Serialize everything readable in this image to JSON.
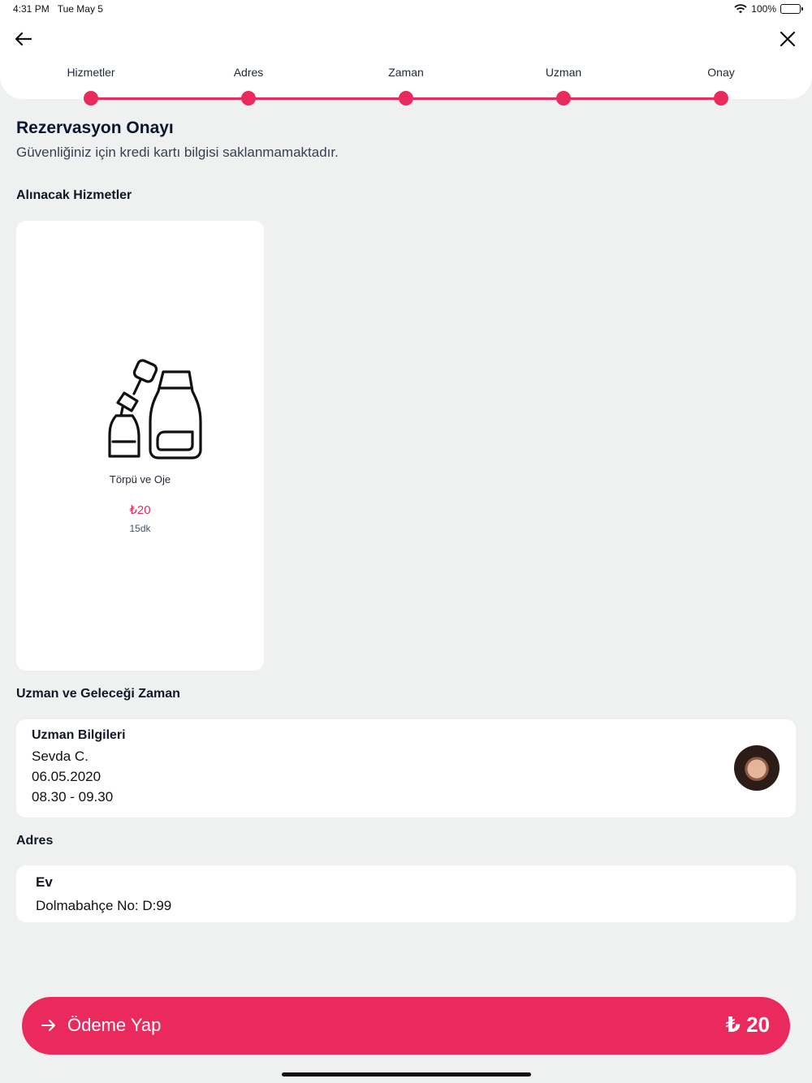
{
  "status_bar": {
    "time": "4:31 PM",
    "date": "Tue May 5",
    "battery": "100%"
  },
  "steps": [
    {
      "label": "Hizmetler"
    },
    {
      "label": "Adres"
    },
    {
      "label": "Zaman"
    },
    {
      "label": "Uzman"
    },
    {
      "label": "Onay"
    }
  ],
  "header": {
    "title": "Rezervasyon Onayı",
    "subtitle": "Güvenliğiniz için kredi kartı bilgisi saklanmamaktadır."
  },
  "services_section": {
    "heading": "Alınacak Hizmetler",
    "items": [
      {
        "icon": "nail-polish-icon",
        "name": "Törpü ve Oje",
        "price": "₺20",
        "duration": "15dk"
      }
    ]
  },
  "expert_section": {
    "heading": "Uzman ve Geleceği Zaman",
    "card_title": "Uzman Bilgileri",
    "expert_name": "Sevda C.",
    "date": "06.05.2020",
    "time_range": "08.30 - 09.30"
  },
  "address_section": {
    "heading": "Adres",
    "label": "Ev",
    "line": "Dolmabahçe No: D:99"
  },
  "pay_button": {
    "label": "Ödeme Yap",
    "amount": "₺ 20"
  },
  "colors": {
    "accent": "#ea2a5c",
    "background": "#eef1ef"
  }
}
